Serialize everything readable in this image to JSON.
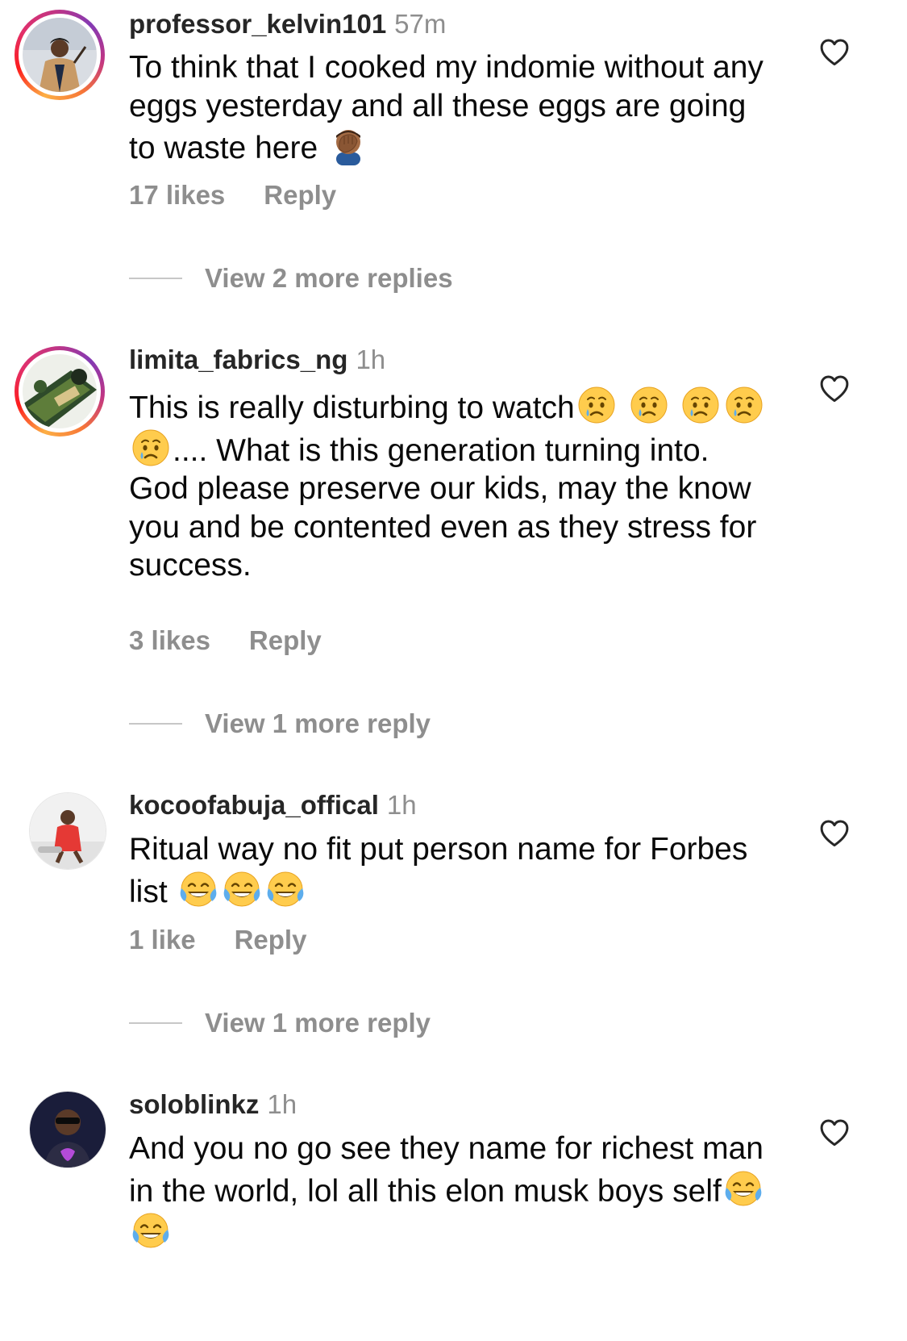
{
  "comments": [
    {
      "username": "professor_kelvin101",
      "time": "57m",
      "text_parts": [
        "To think that I cooked my indomie without any eggs yesterday and all these eggs are going to waste here"
      ],
      "emojis": [
        "face-palm-emoji"
      ],
      "likes": "17 likes",
      "reply_label": "Reply",
      "view_replies": "View 2 more replies",
      "has_story_ring": true
    },
    {
      "username": "limita_fabrics_ng",
      "time": "1h",
      "text_parts": [
        "This is really disturbing to watch",
        ".... What is this generation turning into. God please preserve our kids, may the know you and be contented even as they stress for success."
      ],
      "emojis": [
        "crying-face-emoji"
      ],
      "likes": "3 likes",
      "reply_label": "Reply",
      "view_replies": "View 1 more reply",
      "has_story_ring": true
    },
    {
      "username": "kocoofabuja_offical",
      "time": "1h",
      "text_parts": [
        "Ritual way no fit put person name for Forbes list"
      ],
      "emojis": [
        "tears-of-joy-emoji"
      ],
      "likes": "1 like",
      "reply_label": "Reply",
      "view_replies": "View 1 more reply",
      "has_story_ring": false
    },
    {
      "username": "soloblinkz",
      "time": "1h",
      "text_parts": [
        "And you no go see they name for richest man in the world, lol all this elon musk boys self"
      ],
      "emojis": [
        "tears-of-joy-emoji"
      ],
      "has_story_ring": false
    }
  ],
  "icons": {
    "like": "heart-outline-icon"
  },
  "colors": {
    "secondary_text": "#8e8e8e",
    "username": "#262626",
    "story_ring_start": "#fcaf45",
    "story_ring_end": "#c13584"
  }
}
